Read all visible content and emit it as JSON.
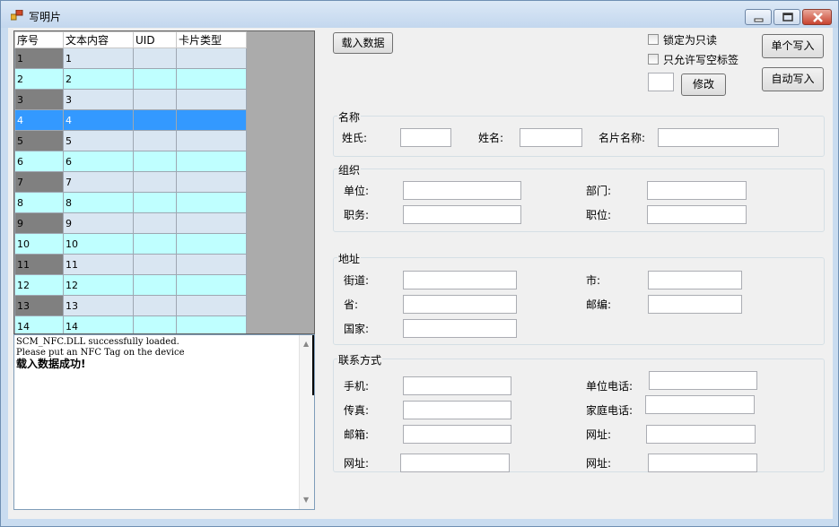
{
  "window": {
    "title": "写明片"
  },
  "grid": {
    "headers": [
      "序号",
      "文本内容",
      "UID",
      "卡片类型"
    ],
    "rows": [
      {
        "n": "1",
        "t": "1",
        "uid": "",
        "type": ""
      },
      {
        "n": "2",
        "t": "2",
        "uid": "",
        "type": ""
      },
      {
        "n": "3",
        "t": "3",
        "uid": "",
        "type": ""
      },
      {
        "n": "4",
        "t": "4",
        "uid": "",
        "type": ""
      },
      {
        "n": "5",
        "t": "5",
        "uid": "",
        "type": ""
      },
      {
        "n": "6",
        "t": "6",
        "uid": "",
        "type": ""
      },
      {
        "n": "7",
        "t": "7",
        "uid": "",
        "type": ""
      },
      {
        "n": "8",
        "t": "8",
        "uid": "",
        "type": ""
      },
      {
        "n": "9",
        "t": "9",
        "uid": "",
        "type": ""
      },
      {
        "n": "10",
        "t": "10",
        "uid": "",
        "type": ""
      },
      {
        "n": "11",
        "t": "11",
        "uid": "",
        "type": ""
      },
      {
        "n": "12",
        "t": "12",
        "uid": "",
        "type": ""
      },
      {
        "n": "13",
        "t": "13",
        "uid": "",
        "type": ""
      },
      {
        "n": "14",
        "t": "14",
        "uid": "",
        "type": ""
      }
    ],
    "selected_row": "4"
  },
  "log": {
    "lines": [
      "SCM_NFC.DLL successfully loaded.",
      "Please put an NFC Tag on the device"
    ],
    "status_line": "载入数据成功!"
  },
  "toolbar": {
    "load_label": "载入数据",
    "lock_label": "锁定为只读",
    "blank_only_label": "只允许写空标签",
    "modify_label": "修改",
    "modify_value": "",
    "single_write_label": "单个写入",
    "auto_write_label": "自动写入"
  },
  "name_group": {
    "title": "名称",
    "surname_label": "姓氏:",
    "surname_value": "",
    "given_label": "姓名:",
    "given_value": "",
    "card_name_label": "名片名称:",
    "card_name_value": ""
  },
  "org_group": {
    "title": "组织",
    "company_label": "单位:",
    "company_value": "",
    "dept_label": "部门:",
    "dept_value": "",
    "duty_label": "职务:",
    "duty_value": "",
    "position_label": "职位:",
    "position_value": ""
  },
  "address_group": {
    "title": "地址",
    "street_label": "街道:",
    "street_value": "",
    "city_label": "市:",
    "city_value": "",
    "province_label": "省:",
    "province_value": "",
    "zip_label": "邮编:",
    "zip_value": "",
    "country_label": "国家:",
    "country_value": ""
  },
  "contact_group": {
    "title": "联系方式",
    "mobile_label": "手机:",
    "mobile_value": "",
    "work_phone_label": "单位电话:",
    "work_phone_value": "",
    "fax_label": "传真:",
    "fax_value": "",
    "home_phone_label": "家庭电话:",
    "home_phone_value": "",
    "email_label": "邮箱:",
    "email_value": "",
    "url1_label": "网址:",
    "url1_value": "",
    "url2_label": "网址:",
    "url2_value": "",
    "url3_label": "网址:",
    "url3_value": ""
  }
}
